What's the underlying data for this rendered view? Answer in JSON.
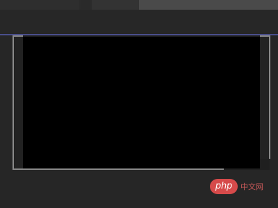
{
  "watermark": {
    "logo_text": "php",
    "site_text": "中文网"
  },
  "colors": {
    "background": "#262626",
    "accent_line": "#4a4f8c",
    "canvas": "#000000",
    "frame_edge": "#8a8a8a",
    "watermark": "#d64a4a"
  }
}
